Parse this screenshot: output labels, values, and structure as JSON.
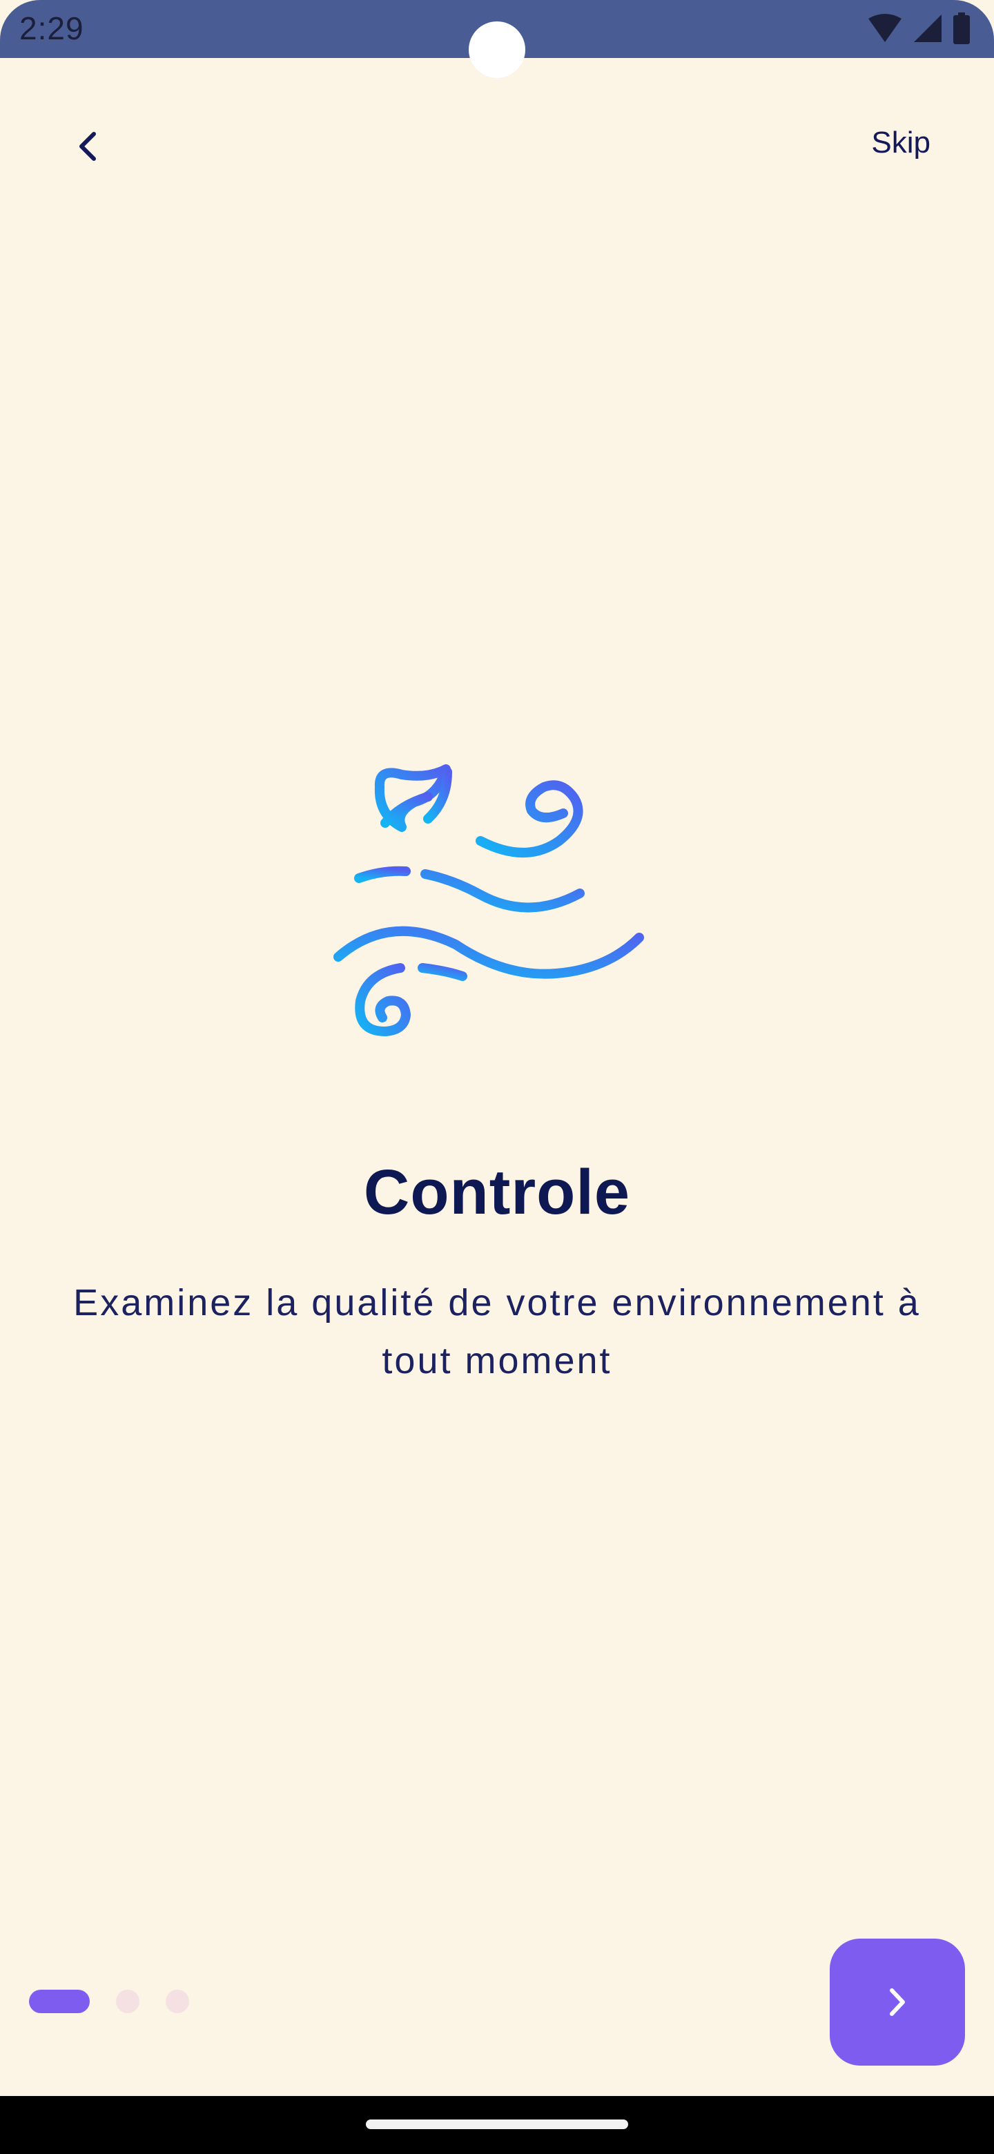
{
  "status_bar": {
    "time": "2:29",
    "icons": [
      "wifi-icon",
      "signal-icon",
      "battery-icon"
    ]
  },
  "header": {
    "back_icon": "chevron-left-icon",
    "skip_label": "Skip"
  },
  "onboarding": {
    "illustration_icon": "wind-leaf-icon",
    "title": "Controle",
    "subtitle_line1": "Examinez la qualité de votre environnement à",
    "subtitle_line2": "tout moment"
  },
  "pager": {
    "total_pages": 3,
    "current_page": 1
  },
  "next_button": {
    "icon": "chevron-right-icon"
  },
  "colors": {
    "background": "#FCF4E4",
    "status_bar": "#4A5C94",
    "text_primary": "#0E1853",
    "accent": "#7E5CF0",
    "dot_inactive": "#F5E1E4",
    "gradient_start": "#14B4F4",
    "gradient_end": "#5260F0"
  }
}
